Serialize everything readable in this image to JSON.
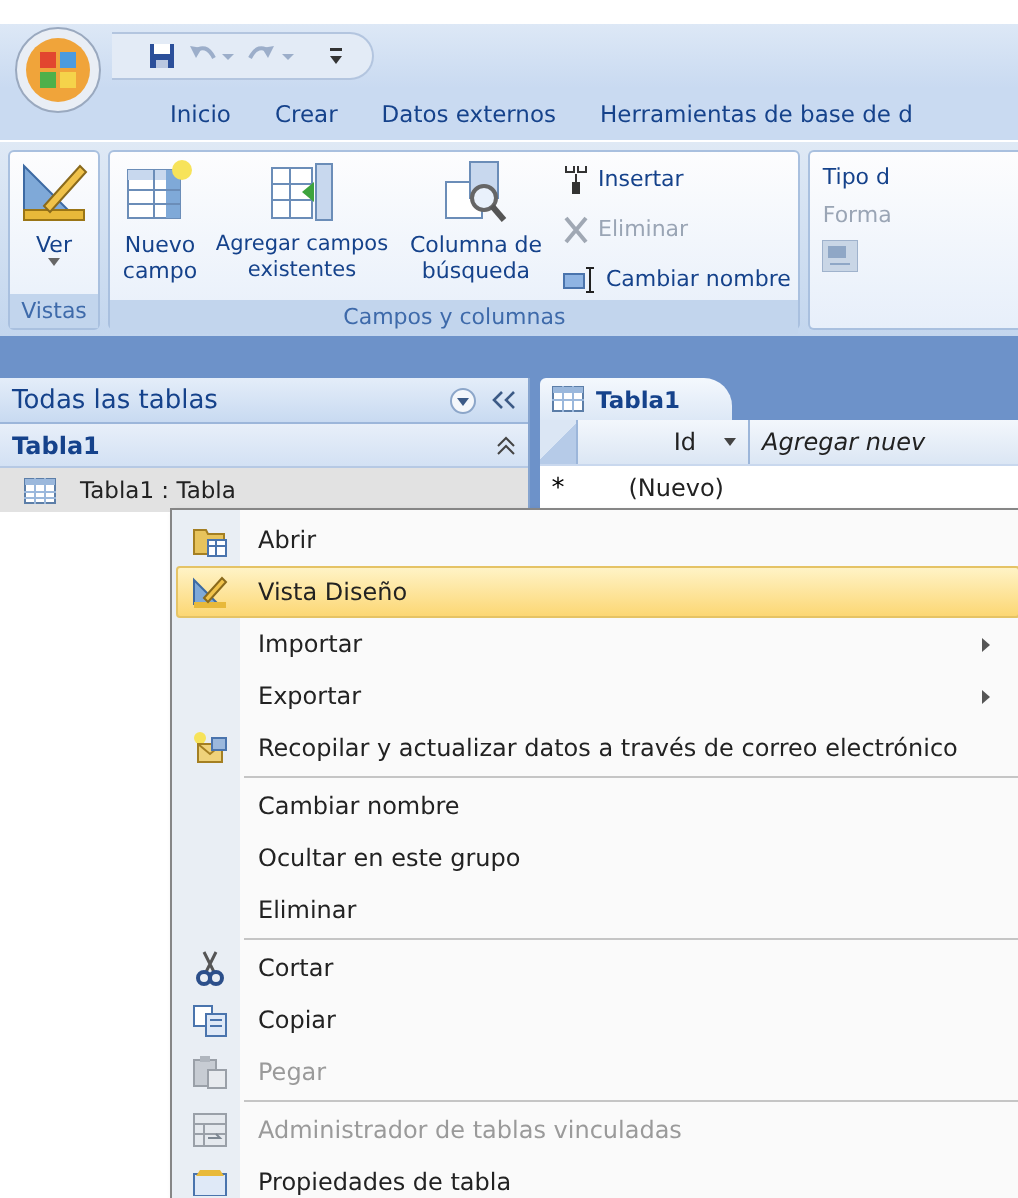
{
  "quick_access": [
    {
      "kind": "save",
      "disabled": false
    },
    {
      "kind": "undo",
      "disabled": true
    },
    {
      "kind": "redo",
      "disabled": true
    },
    {
      "kind": "customize",
      "disabled": false
    }
  ],
  "tabs": [
    {
      "label": "Inicio",
      "selected": false
    },
    {
      "label": "Crear",
      "selected": false
    },
    {
      "label": "Datos externos",
      "selected": false
    },
    {
      "label": "Herramientas de base de d",
      "selected": false
    }
  ],
  "ribbon": {
    "groups": [
      {
        "label": "Vistas",
        "large_buttons": [
          {
            "label": "Ver",
            "kind": "design",
            "dropdown": true
          }
        ]
      },
      {
        "label": "Campos y columnas",
        "large_buttons": [
          {
            "label": "Nuevo campo",
            "kind": "new-field",
            "dropdown": false
          },
          {
            "label": "Agregar campos existentes",
            "kind": "add-fields",
            "dropdown": false
          },
          {
            "label": "Columna de búsqueda",
            "kind": "lookup",
            "dropdown": false
          }
        ],
        "small_buttons": [
          {
            "label": "Insertar",
            "kind": "insert",
            "disabled": false
          },
          {
            "label": "Eliminar",
            "kind": "delete",
            "disabled": true
          },
          {
            "label": "Cambiar nombre",
            "kind": "rename",
            "disabled": false
          }
        ]
      }
    ],
    "partial_group": {
      "items": [
        {
          "label": "Tipo d",
          "disabled": false
        },
        {
          "label": "Forma",
          "disabled": true
        }
      ]
    }
  },
  "navigation": {
    "title": "Todas las tablas",
    "group": "Tabla1",
    "items": [
      {
        "label": "Tabla1 : Tabla",
        "selected": true
      }
    ]
  },
  "document": {
    "tab": "Tabla1",
    "columns": [
      "Id",
      "Agregar nuev"
    ],
    "new_row_marker": "*",
    "new_row_value": "(Nuevo)"
  },
  "context_menu": {
    "groups": [
      [
        {
          "label": "Abrir",
          "kind": "open",
          "selected": false,
          "disabled": false,
          "submenu": false
        },
        {
          "label": "Vista Diseño",
          "kind": "design",
          "selected": true,
          "disabled": false,
          "submenu": false
        },
        {
          "label": "Importar",
          "kind": "plain",
          "selected": false,
          "disabled": false,
          "submenu": true
        },
        {
          "label": "Exportar",
          "kind": "plain",
          "selected": false,
          "disabled": false,
          "submenu": true
        },
        {
          "label": "Recopilar y actualizar datos a través de correo electrónico",
          "kind": "collect",
          "selected": false,
          "disabled": false,
          "submenu": false
        }
      ],
      [
        {
          "label": "Cambiar nombre",
          "kind": "plain",
          "selected": false,
          "disabled": false,
          "submenu": false
        },
        {
          "label": "Ocultar en este grupo",
          "kind": "plain",
          "selected": false,
          "disabled": false,
          "submenu": false
        },
        {
          "label": "Eliminar",
          "kind": "plain",
          "selected": false,
          "disabled": false,
          "submenu": false
        }
      ],
      [
        {
          "label": "Cortar",
          "kind": "cut",
          "selected": false,
          "disabled": false,
          "submenu": false
        },
        {
          "label": "Copiar",
          "kind": "copy",
          "selected": false,
          "disabled": false,
          "submenu": false
        },
        {
          "label": "Pegar",
          "kind": "paste",
          "selected": false,
          "disabled": true,
          "submenu": false
        }
      ],
      [
        {
          "label": "Administrador de tablas vinculadas",
          "kind": "linked",
          "selected": false,
          "disabled": true,
          "submenu": false
        },
        {
          "label": "Propiedades de tabla",
          "kind": "properties",
          "selected": false,
          "disabled": false,
          "submenu": false
        }
      ]
    ]
  }
}
